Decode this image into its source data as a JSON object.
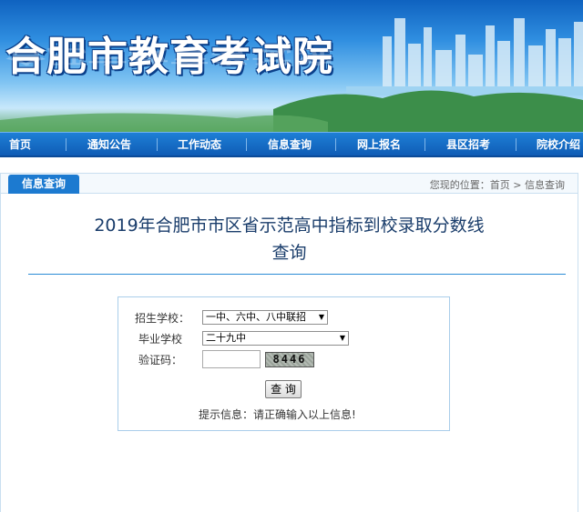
{
  "site": {
    "title": "合肥市教育考试院"
  },
  "nav": {
    "items": [
      "首页",
      "通知公告",
      "工作动态",
      "信息查询",
      "网上报名",
      "县区招考",
      "院校介绍"
    ]
  },
  "panel": {
    "tab_label": "信息查询",
    "breadcrumb": {
      "prefix": "您现的位置：",
      "home": "首页",
      "sep": ">",
      "current": "信息查询"
    },
    "title_line1": "2019年合肥市市区省示范高中指标到校录取分数线",
    "title_line2": "查询"
  },
  "form": {
    "enroll_school_label": "招生学校：",
    "enroll_school_value": "一中、六中、八中联招",
    "grad_school_label": "毕业学校",
    "grad_school_value": "二十九中",
    "captcha_label": "验证码：",
    "captcha_text": "8446",
    "submit_label": "查 询",
    "hint": "提示信息：请正确输入以上信息!"
  },
  "colors": {
    "nav_bg": "#1565c0",
    "tab_bg": "#1c7ad0",
    "title_text": "#1a3d6b",
    "rule": "#2a8cd6"
  }
}
